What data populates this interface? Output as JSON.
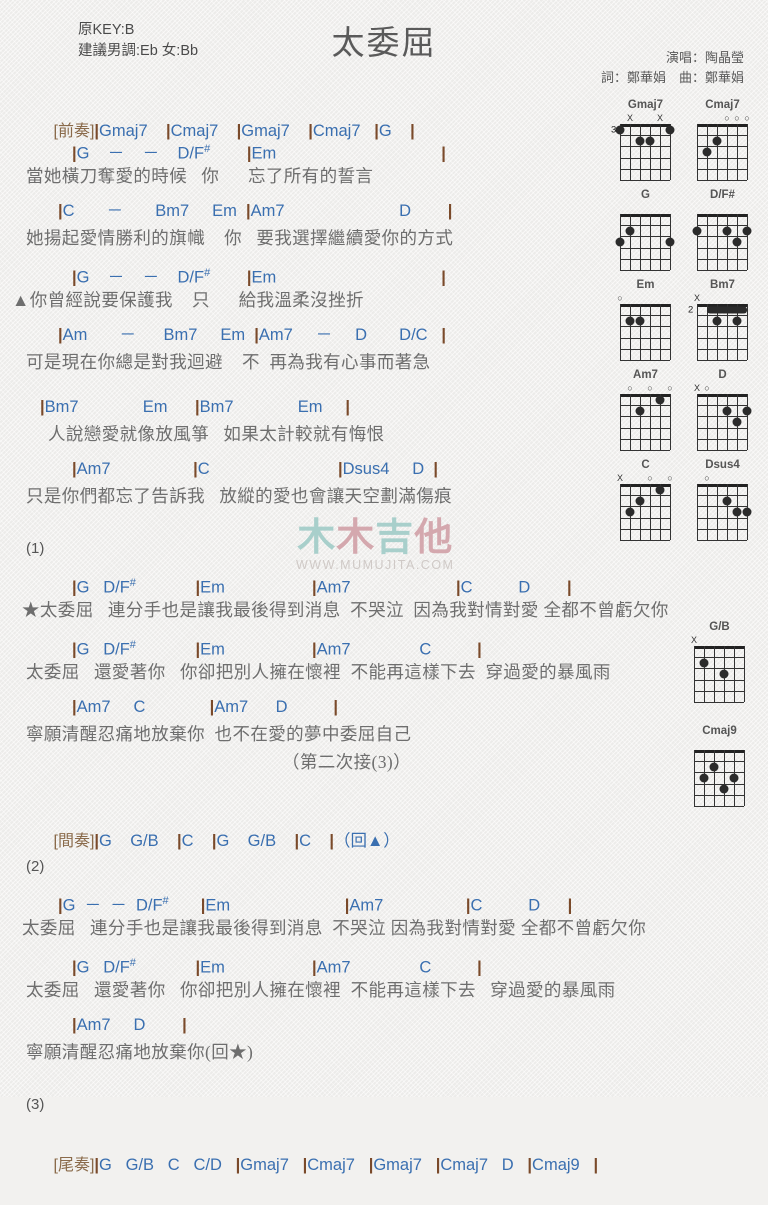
{
  "header": {
    "key_line1": "原KEY:B",
    "key_line2": "建議男調:Eb 女:Bb",
    "title": "太委屈",
    "singer": "演唱：陶晶瑩",
    "writers": "詞：鄭華娟　曲：鄭華娟"
  },
  "watermark": {
    "char1": "木",
    "char2": "木",
    "char3": "吉",
    "char4": "他",
    "url": "WWW.MUMUJITA.COM"
  },
  "intro": {
    "tag": "[前奏]",
    "chords": "|Gmaj7    |Cmaj7    |Gmaj7    |Cmaj7   |G    |"
  },
  "verse1": {
    "l1_chords": "|G    －    －    D/F#        |Em                                    |",
    "l1_lyrics": "當她橫刀奪愛的時候   你      忘了所有的誓言",
    "l2_chords": "|C       －       Bm7     Em  |Am7                         D        |",
    "l2_lyrics": "她揚起愛情勝利的旗幟    你   要我選擇繼續愛你的方式",
    "l3_chords": "|G    －    －    D/F#        |Em                                    |",
    "l3_lyrics": "▲你曾經說要保護我    只      給我溫柔沒挫折",
    "l4_chords": "|Am       －      Bm7     Em  |Am7     －     D       D/C   |",
    "l4_lyrics": "可是現在你總是對我迴避    不  再為我有心事而著急",
    "l5_chords": "|Bm7              Em      |Bm7              Em     |",
    "l5_lyrics": "人說戀愛就像放風箏   如果太計較就有悔恨",
    "l6_chords": "|Am7                  |C                            |Dsus4     D  |",
    "l6_lyrics": "只是你們都忘了告訴我   放縱的愛也會讓天空劃滿傷痕"
  },
  "section1": {
    "number": "(1)",
    "l1_chords": "|G   D/F#             |Em                   |Am7                       |C          D        |",
    "l1_lyrics": "★太委屈   連分手也是讓我最後得到消息  不哭泣  因為我對情對愛 全都不曾虧欠你",
    "l2_chords": "|G   D/F#             |Em                   |Am7               C          |",
    "l2_lyrics": "太委屈   還愛著你   你卻把別人擁在懷裡  不能再這樣下去  穿過愛的暴風雨",
    "l3_chords": "|Am7     C              |Am7      D          |",
    "l3_lyrics": "寧願清醒忍痛地放棄你  也不在愛的夢中委屈自己",
    "note": "（第二次接(3)）"
  },
  "interlude": {
    "tag": "[間奏]",
    "chords": "|G    G/B    |C    |G    G/B    |C    |（回▲）"
  },
  "section2": {
    "number": "(2)",
    "l1_chords": "|G  －  －  D/F#       |Em                         |Am7                  |C          D      |",
    "l1_lyrics": "太委屈   連分手也是讓我最後得到消息  不哭泣 因為我對情對愛 全都不曾虧欠你",
    "l2_chords": "|G   D/F#             |Em                   |Am7               C          |",
    "l2_lyrics": "太委屈   還愛著你   你卻把別人擁在懷裡  不能再這樣下去   穿過愛的暴風雨",
    "l3_chords": "|Am7     D        |",
    "l3_lyrics": "寧願清醒忍痛地放棄你(回★)"
  },
  "section3": {
    "number": "(3)",
    "tag": "[尾奏]",
    "chords": "|G   G/B   C   C/D   |Gmaj7   |Cmaj7   |Gmaj7   |Cmaj7   D   |Cmaj9   |"
  },
  "diagrams": [
    {
      "name": "Gmaj7",
      "marks": [
        {
          "text": "X",
          "string": 2
        },
        {
          "text": "X",
          "string": 5
        }
      ],
      "fret_label": "3",
      "fret_label_string": 6,
      "dots": [
        {
          "string": 6,
          "fret": 1
        },
        {
          "string": 4,
          "fret": 2
        },
        {
          "string": 3,
          "fret": 2
        },
        {
          "string": 1,
          "fret": 1
        }
      ]
    },
    {
      "name": "Cmaj7",
      "marks": [
        {
          "text": "O",
          "string": 3
        },
        {
          "text": "O",
          "string": 2
        },
        {
          "text": "O",
          "string": 1
        }
      ],
      "dots": [
        {
          "string": 5,
          "fret": 3
        },
        {
          "string": 4,
          "fret": 2
        }
      ]
    },
    {
      "name": "G",
      "marks": [],
      "dots": [
        {
          "string": 6,
          "fret": 3
        },
        {
          "string": 5,
          "fret": 2
        },
        {
          "string": 1,
          "fret": 3
        }
      ]
    },
    {
      "name": "D/F#",
      "marks": [],
      "dots": [
        {
          "string": 6,
          "fret": 2
        },
        {
          "string": 3,
          "fret": 2
        },
        {
          "string": 2,
          "fret": 3
        },
        {
          "string": 1,
          "fret": 2
        }
      ]
    },
    {
      "name": "Em",
      "marks": [
        {
          "text": "O",
          "string": 6
        }
      ],
      "dots": [
        {
          "string": 5,
          "fret": 2
        },
        {
          "string": 4,
          "fret": 2
        }
      ]
    },
    {
      "name": "Bm7",
      "marks": [
        {
          "text": "X",
          "string": 6
        }
      ],
      "fret_label": "2",
      "fret_label_string": 6,
      "barre": {
        "fret": 1,
        "from": 5,
        "to": 1
      },
      "dots": [
        {
          "string": 4,
          "fret": 2
        },
        {
          "string": 2,
          "fret": 2
        }
      ]
    },
    {
      "name": "Am7",
      "marks": [
        {
          "text": "O",
          "string": 5
        },
        {
          "text": "O",
          "string": 3
        },
        {
          "text": "O",
          "string": 1
        }
      ],
      "dots": [
        {
          "string": 4,
          "fret": 2
        },
        {
          "string": 2,
          "fret": 1
        }
      ]
    },
    {
      "name": "D",
      "marks": [
        {
          "text": "X",
          "string": 6
        },
        {
          "text": "O",
          "string": 5
        }
      ],
      "dots": [
        {
          "string": 3,
          "fret": 2
        },
        {
          "string": 2,
          "fret": 3
        },
        {
          "string": 1,
          "fret": 2
        }
      ]
    },
    {
      "name": "C",
      "marks": [
        {
          "text": "X",
          "string": 6
        },
        {
          "text": "O",
          "string": 3
        },
        {
          "text": "O",
          "string": 1
        }
      ],
      "dots": [
        {
          "string": 5,
          "fret": 3
        },
        {
          "string": 4,
          "fret": 2
        },
        {
          "string": 2,
          "fret": 1
        }
      ]
    },
    {
      "name": "Dsus4",
      "marks": [
        {
          "text": "O",
          "string": 5
        }
      ],
      "dots": [
        {
          "string": 3,
          "fret": 2
        },
        {
          "string": 2,
          "fret": 3
        },
        {
          "string": 1,
          "fret": 3
        }
      ]
    }
  ],
  "diagrams_lower": [
    {
      "name": "G/B",
      "marks": [
        {
          "text": "X",
          "string": 6
        }
      ],
      "dots": [
        {
          "string": 5,
          "fret": 2
        },
        {
          "string": 3,
          "fret": 3
        }
      ]
    },
    {
      "name": "Cmaj9",
      "marks": [],
      "dots": [
        {
          "string": 4,
          "fret": 2
        },
        {
          "string": 5,
          "fret": 3
        },
        {
          "string": 2,
          "fret": 3
        },
        {
          "string": 3,
          "fret": 4
        }
      ]
    }
  ]
}
